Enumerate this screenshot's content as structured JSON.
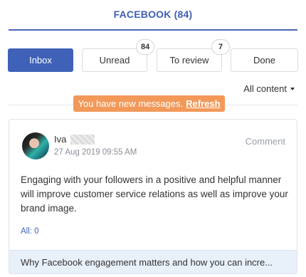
{
  "header": {
    "title": "FACEBOOK (84)"
  },
  "tabs": [
    {
      "label": "Inbox"
    },
    {
      "label": "Unread",
      "badge": "84"
    },
    {
      "label": "To review",
      "badge": "7"
    },
    {
      "label": "Done"
    }
  ],
  "filter": {
    "label": "All content"
  },
  "notice": {
    "text": "You have new messages.",
    "link": "Refresh"
  },
  "post": {
    "author": "Iva",
    "date": "27 Aug 2019 09:55 AM",
    "type": "Comment",
    "body": "Engaging with your followers in a positive and helpful manner will improve customer service relations as well as improve your brand image.",
    "count": "All: 0",
    "link_preview": "Why Facebook engagement matters and how you can incre..."
  },
  "colors": {
    "brand": "#3f62b8",
    "notice": "#f2995a",
    "preview_bg": "#e8f0fa"
  }
}
